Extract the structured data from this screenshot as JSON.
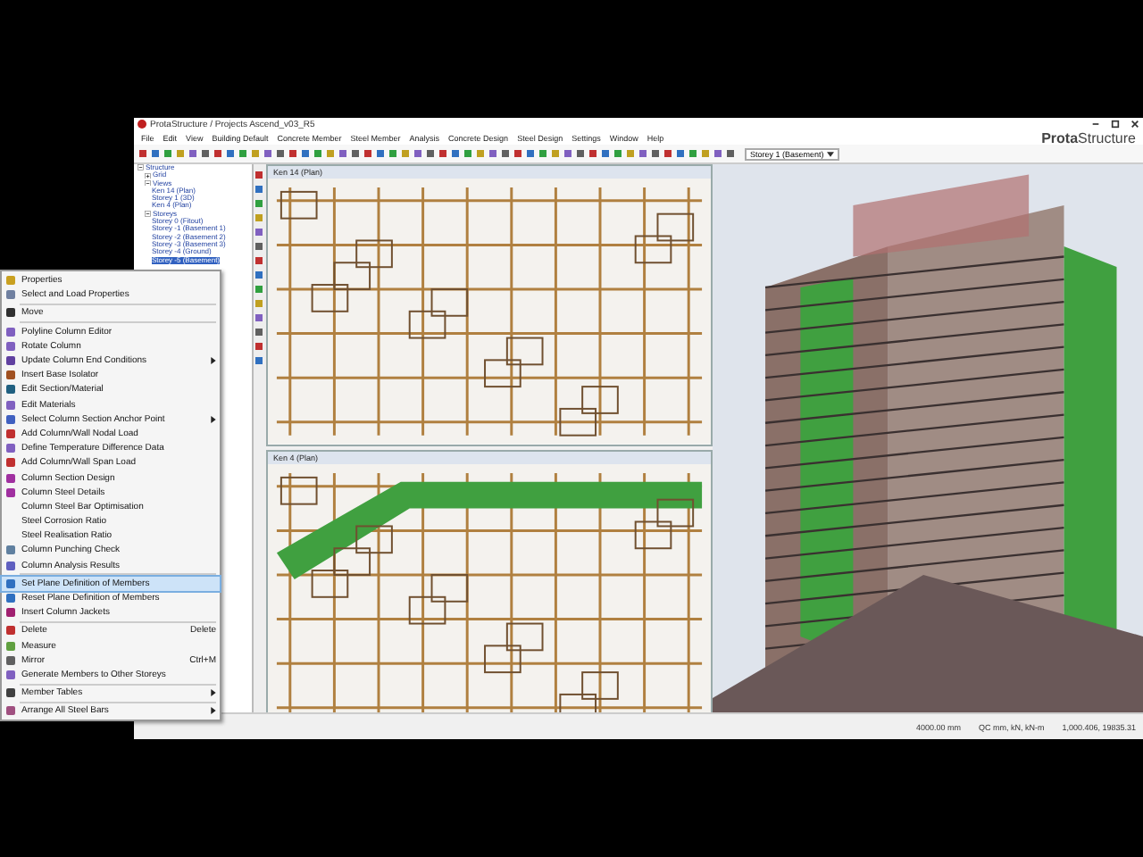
{
  "window": {
    "title": "ProtaStructure / Projects Ascend_v03_R5",
    "brand": {
      "bold": "Prota",
      "light": "Structure"
    }
  },
  "menu_bar": [
    "File",
    "Edit",
    "View",
    "Building Default",
    "Concrete Member",
    "Steel Member",
    "Analysis",
    "Concrete Design",
    "Steel Design",
    "Settings",
    "Window",
    "Help"
  ],
  "storey_dropdown": "Storey 1 (Basement)",
  "tree": [
    {
      "label": "Structure",
      "expanded": true,
      "children": [
        {
          "label": "Grid",
          "expanded": false
        },
        {
          "label": "Views",
          "expanded": true,
          "children": [
            {
              "label": "Ken 14 (Plan)",
              "selected": false
            },
            {
              "label": "Storey 1 (3D)",
              "selected": false
            },
            {
              "label": "Ken 4 (Plan)",
              "selected": false
            }
          ]
        },
        {
          "label": "Storeys",
          "expanded": true,
          "children": [
            {
              "label": "Storey 0 (Fitout)",
              "selected": false
            },
            {
              "label": "Storey -1 (Basement 1)",
              "selected": false
            },
            {
              "label": "Storey -2 (Basement 2)",
              "selected": false
            },
            {
              "label": "Storey -3 (Basement 3)",
              "selected": false
            },
            {
              "label": "Storey -4 (Ground)",
              "selected": false
            },
            {
              "label": "Storey -5 (Basement)",
              "selected": true
            }
          ]
        }
      ]
    }
  ],
  "views": [
    {
      "title": "Ken 14 (Plan)"
    },
    {
      "title": "Ken 4 (Plan)"
    }
  ],
  "context_menu": [
    {
      "label": "Properties",
      "selected": false
    },
    {
      "label": "Select and Load Properties",
      "selected": false,
      "separator_after": true
    },
    {
      "label": "Move",
      "selected": false,
      "separator_after": true
    },
    {
      "label": "Polyline Column Editor",
      "selected": false
    },
    {
      "label": "Rotate Column",
      "selected": false
    },
    {
      "label": "Update Column End Conditions",
      "selected": false,
      "submenu": true
    },
    {
      "label": "Insert Base Isolator",
      "selected": false
    },
    {
      "label": "Edit Section/Material",
      "selected": false
    },
    {
      "label": "Edit Materials",
      "selected": false
    },
    {
      "label": "Select Column Section Anchor Point",
      "selected": false,
      "submenu": true
    },
    {
      "label": "Add Column/Wall Nodal Load",
      "selected": false
    },
    {
      "label": "Define Temperature Difference Data",
      "selected": false
    },
    {
      "label": "Add Column/Wall Span Load",
      "selected": false
    },
    {
      "label": "Column Section Design",
      "selected": false
    },
    {
      "label": "Column Steel Details",
      "selected": false
    },
    {
      "label": "Column Steel Bar Optimisation",
      "selected": false
    },
    {
      "label": "Steel Corrosion Ratio",
      "selected": false
    },
    {
      "label": "Steel Realisation Ratio",
      "selected": false
    },
    {
      "label": "Column Punching Check",
      "selected": false
    },
    {
      "label": "Column Analysis Results",
      "selected": false,
      "separator_after": true
    },
    {
      "label": "Set Plane Definition of Members",
      "selected": true
    },
    {
      "label": "Reset Plane Definition of Members",
      "selected": false
    },
    {
      "label": "Insert Column Jackets",
      "selected": false,
      "separator_after": true
    },
    {
      "label": "Delete",
      "selected": false,
      "shortcut": "Delete"
    },
    {
      "label": "Measure",
      "selected": false
    },
    {
      "label": "Mirror",
      "selected": false,
      "shortcut": "Ctrl+M"
    },
    {
      "label": "Generate Members to Other Storeys",
      "selected": false,
      "separator_after": true
    },
    {
      "label": "Member Tables",
      "selected": false,
      "submenu": true,
      "separator_after": true
    },
    {
      "label": "Arrange All Steel Bars",
      "selected": false,
      "submenu": true
    }
  ],
  "status_bar": [
    "4000.00 mm",
    "QC mm, kN, kN-m",
    "1,000.406, 19835.31"
  ]
}
